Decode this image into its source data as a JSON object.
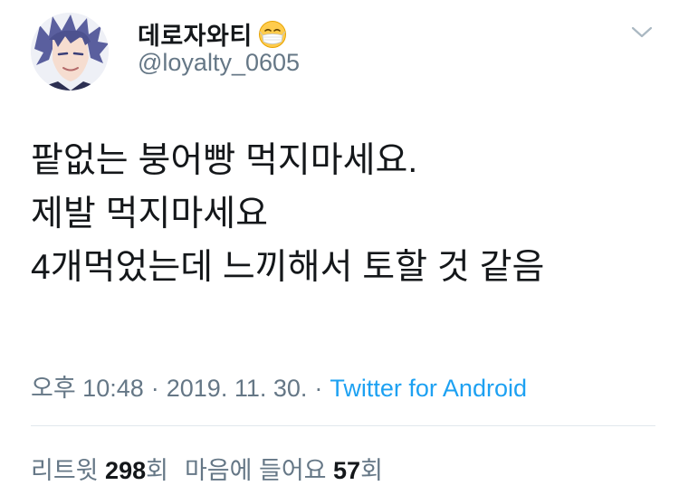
{
  "header": {
    "display_name": "데로자와티",
    "handle": "@loyalty_0605",
    "emoji_icon": "face-with-medical-mask-icon",
    "menu_icon": "chevron-down-icon",
    "avatar_icon": "anime-character-avatar"
  },
  "tweet": {
    "lines": [
      "팥없는 붕어빵 먹지마세요.",
      "제발 먹지마세요",
      "4개먹었는데 느끼해서 토할 것 같음"
    ]
  },
  "meta": {
    "time": "오후 10:48",
    "separator": "·",
    "date": "2019. 11. 30.",
    "source": "Twitter for Android"
  },
  "stats": {
    "retweets_label": "리트윗",
    "retweets_count": "298",
    "retweets_unit": "회",
    "likes_label": "마음에 들어요",
    "likes_count": "57",
    "likes_unit": "회"
  },
  "colors": {
    "text_primary": "#14171a",
    "text_secondary": "#657786",
    "link": "#1da1f2",
    "divider": "#e1e8ed"
  }
}
